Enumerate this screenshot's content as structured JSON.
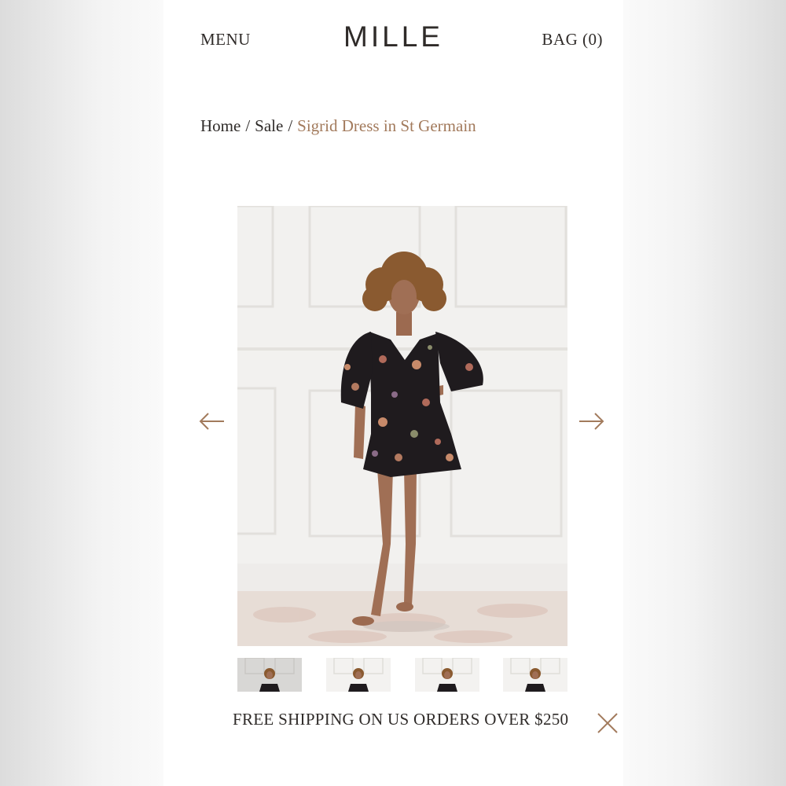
{
  "header": {
    "menu_label": "MENU",
    "brand": "MILLE",
    "bag_label": "BAG (0)"
  },
  "breadcrumb": {
    "items": [
      "Home",
      "Sale"
    ],
    "current": "Sigrid Dress in St Germain"
  },
  "gallery": {
    "prev_icon": "arrow-left-icon",
    "next_icon": "arrow-right-icon",
    "thumbnail_count": 4,
    "active_thumbnail": 1
  },
  "promo": {
    "text": "FREE SHIPPING ON US ORDERS OVER $250",
    "close_icon": "close-icon"
  },
  "colors": {
    "accent": "#a27a5c",
    "text": "#2f2b29",
    "background": "#ffffff"
  }
}
